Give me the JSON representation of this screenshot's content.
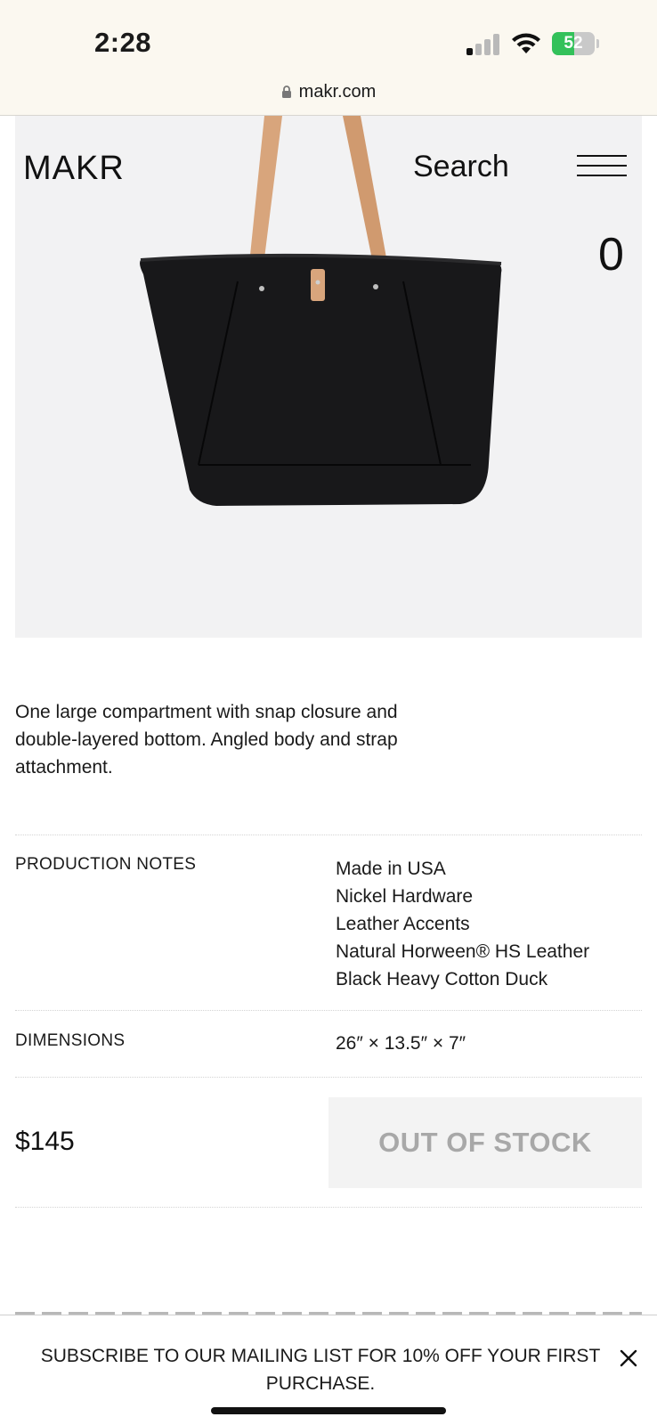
{
  "status_bar": {
    "time": "2:28",
    "battery": "52",
    "battery_level": 0.52,
    "battery_color": "#33c15a"
  },
  "browser": {
    "url": "makr.com"
  },
  "header": {
    "logo": "MAKR",
    "search_label": "Search",
    "cart_count": "0"
  },
  "product": {
    "description": "One large compartment with snap closure and double-layered bottom. Angled body and strap attachment.",
    "production_notes_label": "PRODUCTION NOTES",
    "production_notes": [
      "Made in USA",
      "Nickel Hardware",
      "Leather Accents",
      "Natural Horween® HS Leather",
      "Black Heavy Cotton Duck"
    ],
    "dimensions_label": "DIMENSIONS",
    "dimensions": "26″ × 13.5″ × 7″",
    "price": "$145",
    "stock_button": "OUT OF STOCK"
  },
  "banner": {
    "text": "SUBSCRIBE TO OUR MAILING LIST FOR 10% OFF YOUR FIRST PURCHASE."
  },
  "colors": {
    "status_bg": "#fbf8f0",
    "hero_bg": "#f2f2f3",
    "strap": "#d8a57c",
    "bag": "#18181a"
  }
}
